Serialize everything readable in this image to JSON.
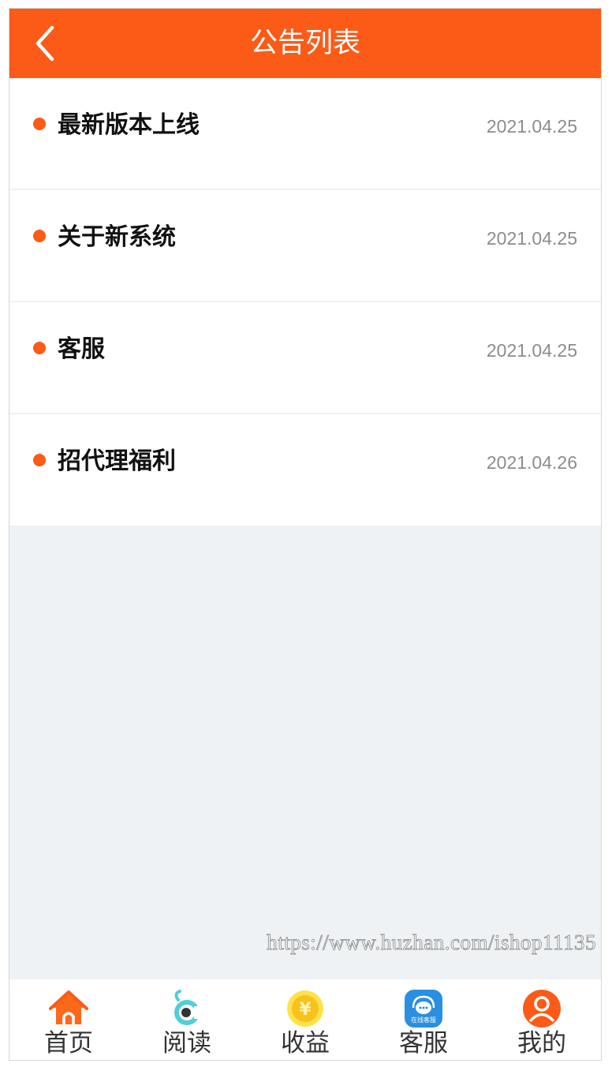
{
  "header": {
    "title": "公告列表",
    "back_icon": "chevron-left-icon"
  },
  "announcements": [
    {
      "title": "最新版本上线",
      "date": "2021.04.25"
    },
    {
      "title": "关于新系统",
      "date": "2021.04.25"
    },
    {
      "title": "客服",
      "date": "2021.04.25"
    },
    {
      "title": "招代理福利",
      "date": "2021.04.26"
    }
  ],
  "watermark": "https://www.huzhan.com/ishop11135",
  "tabbar": {
    "items": [
      {
        "label": "首页",
        "icon": "home-icon"
      },
      {
        "label": "阅读",
        "icon": "read-eye-icon"
      },
      {
        "label": "收益",
        "icon": "coin-yen-icon"
      },
      {
        "label": "客服",
        "icon": "customer-service-icon",
        "icon_text": "在线客服"
      },
      {
        "label": "我的",
        "icon": "user-profile-icon"
      }
    ]
  },
  "colors": {
    "accent": "#fb5b17",
    "background": "#eff2f5",
    "date_text": "#8c8c8c"
  }
}
